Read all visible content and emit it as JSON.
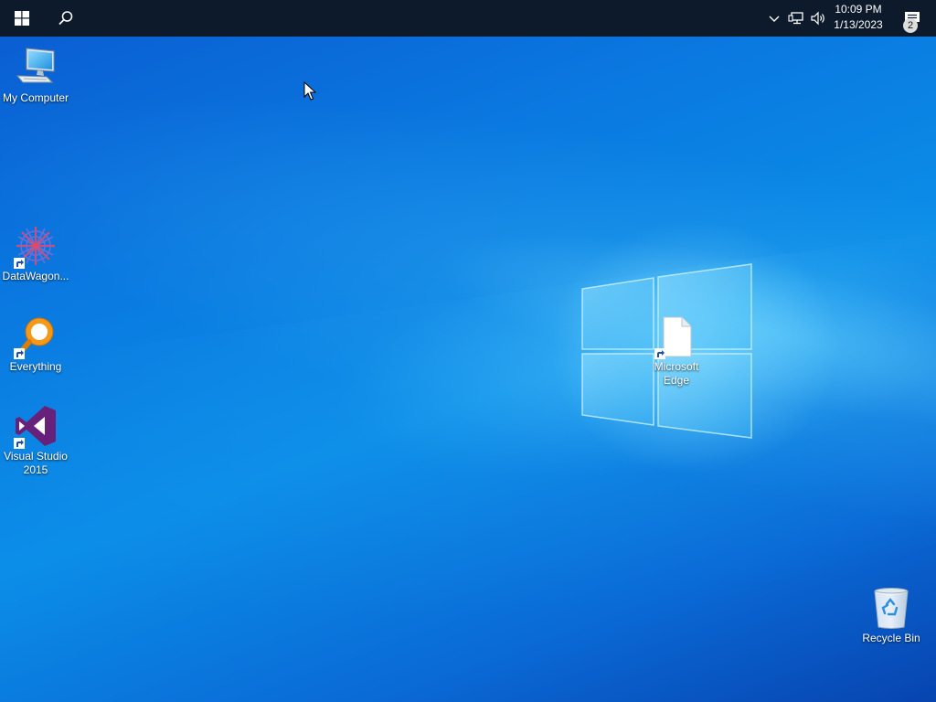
{
  "taskbar": {
    "start_icon": "windows-logo-icon",
    "search_icon": "search-icon",
    "tray": {
      "chevron_icon": "chevron-up-icon",
      "network_icon": "network-icon",
      "volume_icon": "volume-icon"
    },
    "clock": {
      "time": "10:09 PM",
      "date": "1/13/2023"
    },
    "notifications": {
      "icon": "action-center-icon",
      "count": "2"
    }
  },
  "desktop": {
    "icons": [
      {
        "label": "My Computer",
        "icon": "computer-icon"
      },
      {
        "label": "DataWagon...",
        "icon": "datawagon-icon"
      },
      {
        "label": "Everything",
        "icon": "everything-search-icon"
      },
      {
        "label": "Visual Studio 2015",
        "icon": "visual-studio-icon"
      },
      {
        "label": "Microsoft Edge",
        "icon": "blank-file-icon"
      },
      {
        "label": "Recycle Bin",
        "icon": "recycle-bin-icon"
      }
    ]
  },
  "colors": {
    "taskbar": "#0c1a2b",
    "wallpaper_primary": "#0a79e0",
    "wallpaper_dark": "#0744b0"
  }
}
